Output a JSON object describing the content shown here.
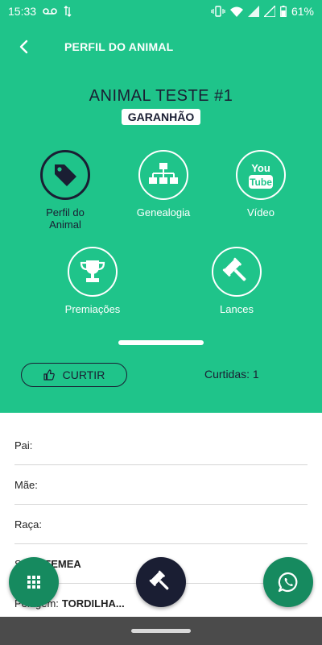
{
  "status_bar": {
    "time": "15:33",
    "battery": "61%"
  },
  "app_bar": {
    "title": "PERFIL DO ANIMAL"
  },
  "animal": {
    "name": "ANIMAL TESTE #1",
    "sex_badge": "GARANHÃO"
  },
  "nav": {
    "profile_label": "Perfil do Animal",
    "genealogy_label": "Genealogia",
    "video_label": "Vídeo",
    "awards_label": "Premiações",
    "bids_label": "Lances"
  },
  "likes": {
    "button_label": "CURTIR",
    "count_text": "Curtidas: 1"
  },
  "details": {
    "father_label": "Pai:",
    "father_value": "",
    "mother_label": "Mãe:",
    "mother_value": "",
    "breed_label": "Raça:",
    "breed_value": "",
    "sex_label": "Sexo:",
    "sex_value": "FEMEA",
    "coat_label": "Pelagem:",
    "coat_value": "TORDILHA..."
  },
  "icons": {
    "back": "arrow-left-icon",
    "profile": "tag-icon",
    "genealogy": "sitemap-icon",
    "video": "youtube-icon",
    "awards": "trophy-icon",
    "bids": "gavel-icon",
    "like": "thumbs-up-icon",
    "grid": "grid-icon",
    "whatsapp": "whatsapp-icon"
  },
  "colors": {
    "primary": "#1fc48a",
    "dark": "#1a1e33",
    "fab_green": "#168a5f"
  }
}
